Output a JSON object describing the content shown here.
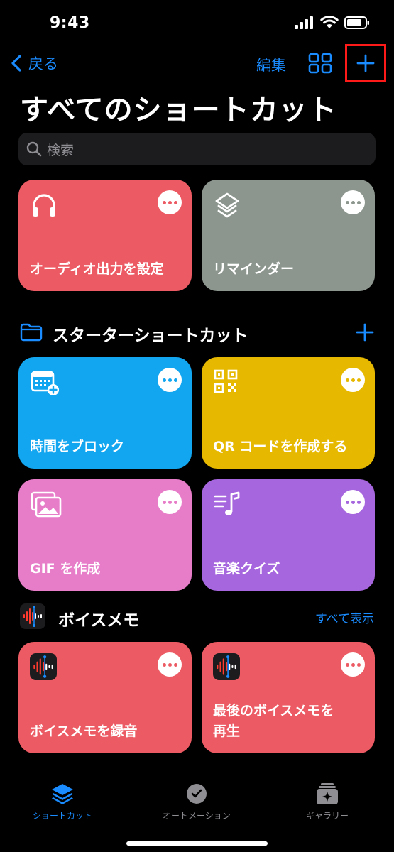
{
  "status_bar": {
    "time": "9:43"
  },
  "nav": {
    "back_label": "戻る",
    "edit_label": "編集"
  },
  "page_title": "すべてのショートカット",
  "search": {
    "placeholder": "検索"
  },
  "top_tiles": [
    {
      "label": "オーディオ出力を設定",
      "color": "#ec5b63",
      "icon": "headphones-icon"
    },
    {
      "label": "リマインダー",
      "color": "#8c968e",
      "icon": "layers-icon"
    }
  ],
  "starter_section": {
    "title": "スターターショートカット",
    "tiles": [
      {
        "label": "時間をブロック",
        "color": "#12a6f0",
        "icon": "calendar-add-icon"
      },
      {
        "label": "QR コードを作成する",
        "color": "#e6b800",
        "icon": "qr-code-icon"
      },
      {
        "label": "GIF を作成",
        "color": "#e77cc9",
        "icon": "photos-icon"
      },
      {
        "label": "音楽クイズ",
        "color": "#a666dd",
        "icon": "music-list-icon"
      }
    ]
  },
  "voice_memo_section": {
    "title": "ボイスメモ",
    "see_all_label": "すべて表示",
    "tiles": [
      {
        "label": "ボイスメモを録音",
        "color": "#ec5b63",
        "icon": "voice-memo-icon"
      },
      {
        "label": "最後のボイスメモを再生",
        "color": "#ec5b63",
        "icon": "voice-memo-icon"
      }
    ]
  },
  "tab_bar": {
    "tabs": [
      {
        "label": "ショートカット",
        "active": true
      },
      {
        "label": "オートメーション",
        "active": false
      },
      {
        "label": "ギャラリー",
        "active": false
      }
    ]
  },
  "colors": {
    "accent": "#1a8cff",
    "highlight_box": "#ff1a1a"
  }
}
